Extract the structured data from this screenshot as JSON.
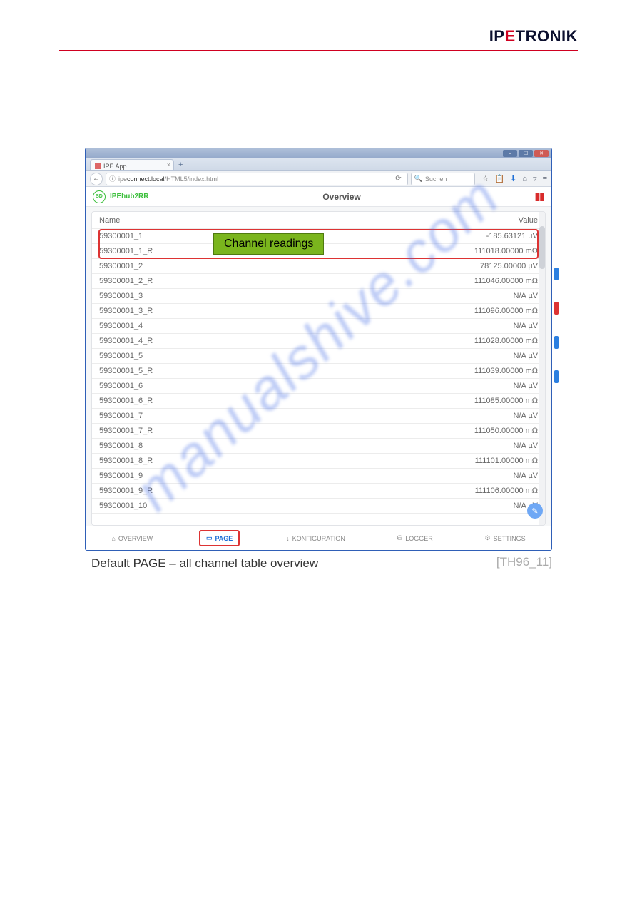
{
  "brand_parts": {
    "ip": "IP",
    "e": "E",
    "tronik": "TRONIK"
  },
  "window": {
    "tab_title": "IPE App",
    "url_prefix": "ipe",
    "url_host": "connect.local",
    "url_path": "/HTML5/index.html",
    "search_placeholder": "Suchen"
  },
  "app": {
    "device_label": "IPEhub2RR",
    "title": "Overview",
    "sd_badge": "SD"
  },
  "table": {
    "head_name": "Name",
    "head_value": "Value",
    "rows": [
      {
        "name": "59300001_1",
        "value": "-185.63121 µV"
      },
      {
        "name": "59300001_1_R",
        "value": "111018.00000 mΩ"
      },
      {
        "name": "59300001_2",
        "value": "78125.00000 µV"
      },
      {
        "name": "59300001_2_R",
        "value": "111046.00000 mΩ"
      },
      {
        "name": "59300001_3",
        "value": "N/A µV"
      },
      {
        "name": "59300001_3_R",
        "value": "111096.00000 mΩ"
      },
      {
        "name": "59300001_4",
        "value": "N/A µV"
      },
      {
        "name": "59300001_4_R",
        "value": "111028.00000 mΩ"
      },
      {
        "name": "59300001_5",
        "value": "N/A µV"
      },
      {
        "name": "59300001_5_R",
        "value": "111039.00000 mΩ"
      },
      {
        "name": "59300001_6",
        "value": "N/A µV"
      },
      {
        "name": "59300001_6_R",
        "value": "111085.00000 mΩ"
      },
      {
        "name": "59300001_7",
        "value": "N/A µV"
      },
      {
        "name": "59300001_7_R",
        "value": "111050.00000 mΩ"
      },
      {
        "name": "59300001_8",
        "value": "N/A µV"
      },
      {
        "name": "59300001_8_R",
        "value": "111101.00000 mΩ"
      },
      {
        "name": "59300001_9",
        "value": "N/A µV"
      },
      {
        "name": "59300001_9_R",
        "value": "111106.00000 mΩ"
      },
      {
        "name": "59300001_10",
        "value": "N/A µV"
      }
    ]
  },
  "callout": "Channel readings",
  "bottomnav": {
    "overview": "OVERVIEW",
    "page": "PAGE",
    "konfiguration": "KONFIGURATION",
    "logger": "LOGGER",
    "settings": "SETTINGS"
  },
  "caption": "Default PAGE – all channel table overview",
  "figref": "[TH96_11]",
  "watermark": "manualshive.com"
}
